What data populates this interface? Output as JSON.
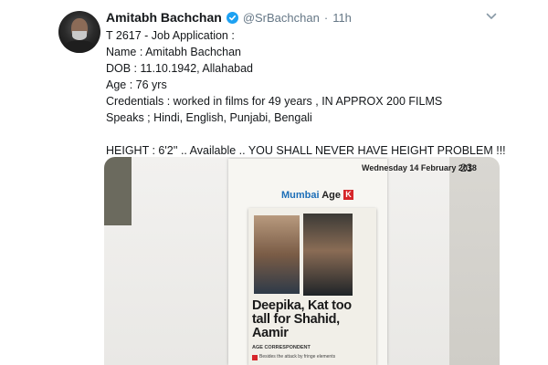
{
  "tweet": {
    "author_name": "Amitabh Bachchan",
    "handle": "@SrBachchan",
    "separator": "·",
    "time": "11h",
    "lines": [
      "T 2617 - Job Application :",
      "Name : Amitabh Bachchan",
      "DOB : 11.10.1942, Allahabad",
      "Age : 76 yrs",
      "Credentials : worked in films for 49 years , IN APPROX 200 FILMS",
      "Speaks ; Hindi, English, Punjabi, Bengali",
      "",
      "HEIGHT : 6'2'' .. Available .. YOU SHALL NEVER HAVE HEIGHT PROBLEM  !!!"
    ]
  },
  "media": {
    "dateline": "Wednesday 14 February 2018",
    "page_number": "23",
    "section_part1": "Mumbai",
    "section_part2": "Age",
    "section_logo": "K",
    "headline": "Deepika, Kat too tall for Shahid, Aamir",
    "byline": "AGE CORRESPONDENT",
    "blurb": "Besides the attack by fringe elements"
  },
  "colors": {
    "verified": "#1da1f2",
    "text_secondary": "#657786",
    "section_blue": "#1d6fb8",
    "section_red": "#d6262a"
  }
}
